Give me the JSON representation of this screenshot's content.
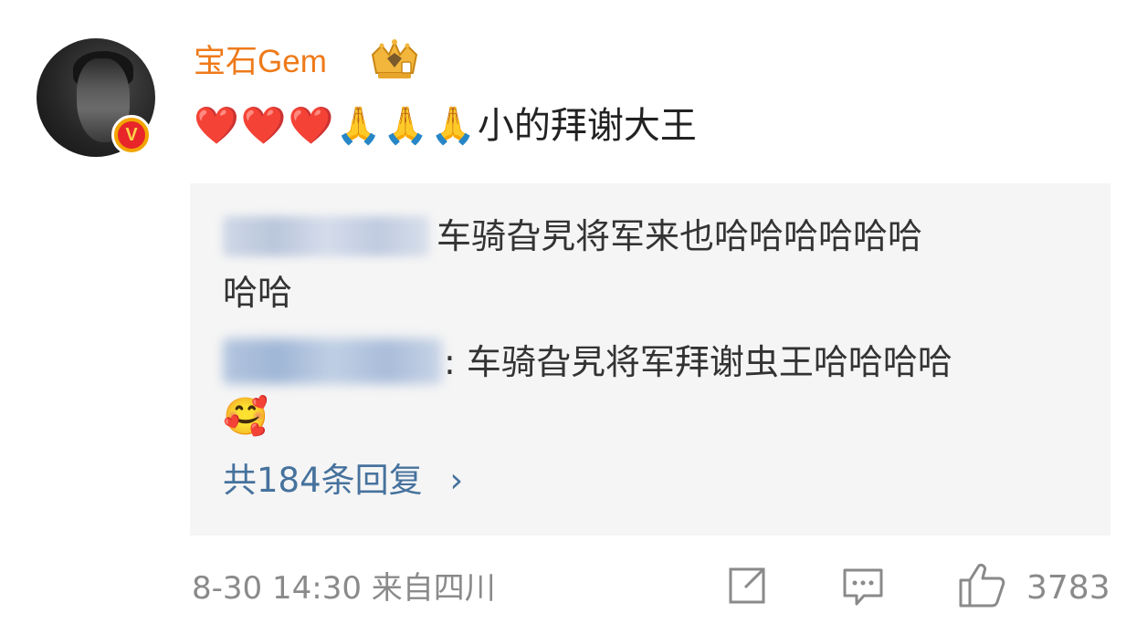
{
  "user": {
    "name": "宝石Gem",
    "badge": "V"
  },
  "comment": {
    "emojis": [
      "❤️",
      "❤️",
      "❤️",
      "🙏",
      "🙏",
      "🙏"
    ],
    "text": "小的拜谢大王"
  },
  "replies": [
    {
      "text_line1": "车骑旮旯将军来也哈哈哈哈哈哈",
      "text_line2": "哈哈"
    },
    {
      "text_line1": ": 车骑旮旯将军拜谢虫王哈哈哈哈",
      "emoji": "🥰"
    }
  ],
  "more_replies": {
    "label": "共184条回复",
    "chevron": "›"
  },
  "footer": {
    "meta": "8-30 14:30  来自四川",
    "like_count": "3783"
  },
  "icons": {
    "repost": "repost-icon",
    "comment": "comment-icon",
    "like": "like-icon"
  },
  "colors": {
    "username": "#ee7a1a",
    "link": "#46729d",
    "reply_bg": "#f5f5f5",
    "meta": "#8a8a8a"
  }
}
